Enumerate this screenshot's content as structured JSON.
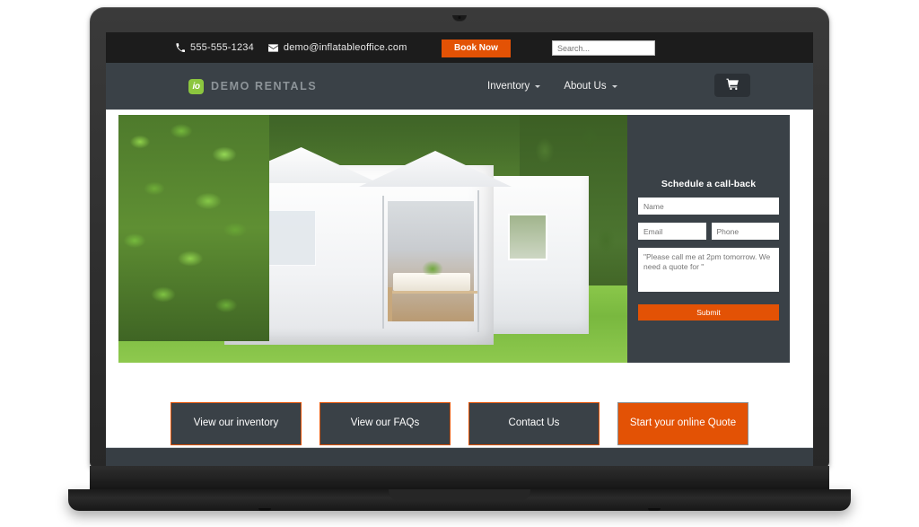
{
  "device": {
    "name": "laptop-mockup"
  },
  "topbar": {
    "phone": "555-555-1234",
    "email": "demo@inflatableoffice.com",
    "book_now_label": "Book Now",
    "search_placeholder": "Search...",
    "search_value": "",
    "background": "#1c1c1c",
    "accent": "#e35205"
  },
  "navbar": {
    "logo_text": "io",
    "brand_name": "DEMO RENTALS",
    "background": "#3a4147",
    "logo_color": "#8cc63f",
    "menu": [
      {
        "label": "Inventory",
        "has_dropdown": true
      },
      {
        "label": "About Us",
        "has_dropdown": true
      }
    ],
    "cart_icon": "shopping-cart-icon"
  },
  "hero": {
    "image_alt": "White event tent with dining table set up on a wooden deck on a green lawn beside tall hedges"
  },
  "callback_form": {
    "title": "Schedule a call-back",
    "name_placeholder": "Name",
    "email_placeholder": "Email",
    "phone_placeholder": "Phone",
    "message_placeholder": "\"Please call me at 2pm tomorrow. We need a quote for \"",
    "submit_label": "Submit",
    "panel_background": "#3a4147",
    "submit_color": "#e35205"
  },
  "cta_buttons": [
    {
      "label": "View our inventory",
      "style": "dark"
    },
    {
      "label": "View our FAQs",
      "style": "dark"
    },
    {
      "label": "Contact Us",
      "style": "dark"
    },
    {
      "label": "Start your online Quote",
      "style": "primary"
    }
  ]
}
